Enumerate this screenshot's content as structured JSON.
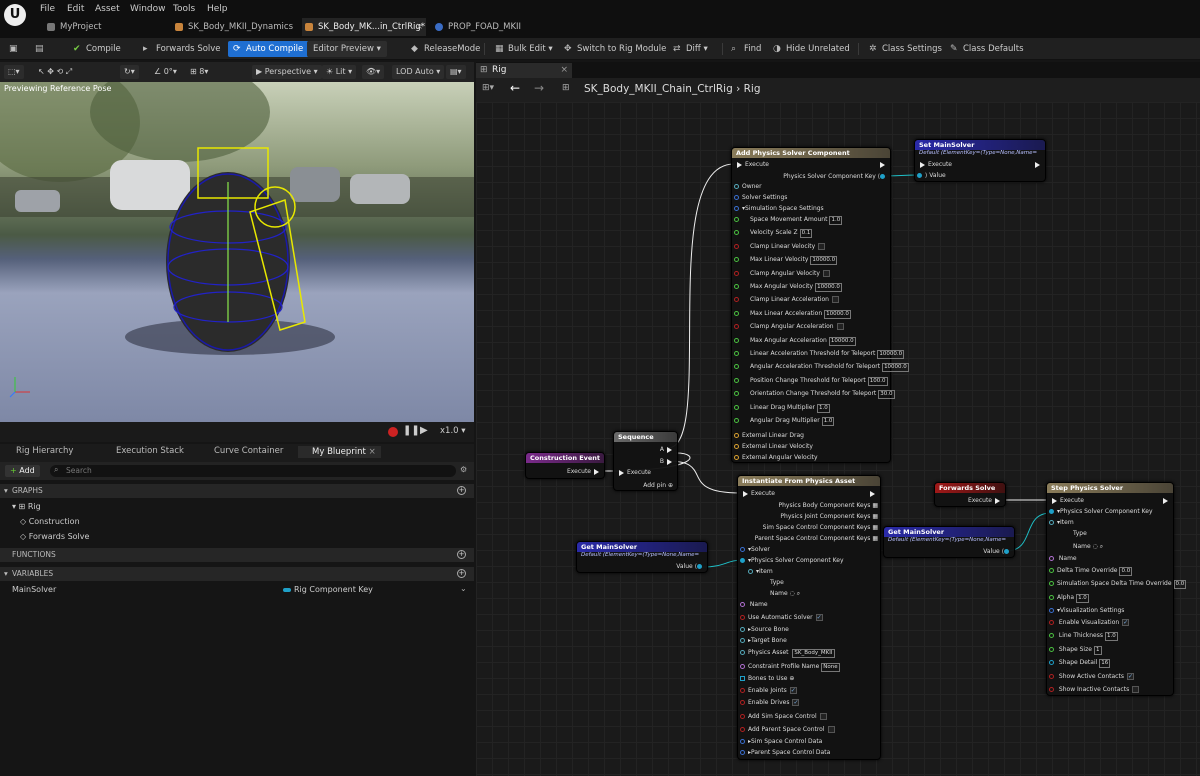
{
  "menu": [
    "File",
    "Edit",
    "Asset",
    "Window",
    "Tools",
    "Help"
  ],
  "tabs": [
    "MyProject",
    "SK_Body_MKII_Dynamics",
    "SK_Body_MK...in_CtrlRig*",
    "PROP_FOAD_MKII"
  ],
  "toolbar": {
    "compile": "Compile",
    "forwards_solve": "Forwards Solve",
    "auto_compile": "Auto Compile",
    "editor_preview": "Editor Preview",
    "release_mode": "ReleaseMode",
    "bulk_edit": "Bulk Edit",
    "switch": "Switch to Rig Module",
    "diff": "Diff",
    "find": "Find",
    "hide_unrelated": "Hide Unrelated",
    "class_settings": "Class Settings",
    "class_defaults": "Class Defaults"
  },
  "viewport": {
    "rotation": "0°",
    "snap": "8",
    "perspective": "Perspective",
    "lit": "Lit",
    "lod": "LOD Auto",
    "label": "Previewing Reference Pose",
    "speed": "x1.0"
  },
  "left_tabs": [
    "Rig Hierarchy",
    "Execution Stack",
    "Curve Container",
    "My Blueprint"
  ],
  "left": {
    "add": "Add",
    "search_placeholder": "Search",
    "graphs": "GRAPHS",
    "rig": "Rig",
    "construction": "Construction",
    "forwards": "Forwards Solve",
    "functions": "FUNCTIONS",
    "variables": "VARIABLES",
    "var_name": "MainSolver",
    "var_type": "Rig Component Key"
  },
  "graph": {
    "tab": "Rig",
    "breadcrumb1": "SK_Body_MKII_Chain_CtrlRig",
    "breadcrumb2": "Rig"
  },
  "nodes": {
    "add_physics": {
      "title": "Add Physics Solver Component",
      "exec": "Execute",
      "out": "Physics Solver Component Key",
      "owner": "Owner",
      "solver_settings": "Solver Settings",
      "sim_space": "Simulation Space Settings",
      "rows": [
        [
          "Space Movement Amount",
          "1.0"
        ],
        [
          "Velocity Scale Z",
          "0.1"
        ],
        [
          "Clamp Linear Velocity",
          ""
        ],
        [
          "Max Linear Velocity",
          "10000.0"
        ],
        [
          "Clamp Angular Velocity",
          ""
        ],
        [
          "Max Angular Velocity",
          "10000.0"
        ],
        [
          "Clamp Linear Acceleration",
          ""
        ],
        [
          "Max Linear Acceleration",
          "10000.0"
        ],
        [
          "Clamp Angular Acceleration",
          ""
        ],
        [
          "Max Angular Acceleration",
          "10000.0"
        ],
        [
          "Linear Acceleration Threshold for Teleport",
          "10000.0"
        ],
        [
          "Angular Acceleration Threshold for Teleport",
          "10000.0"
        ],
        [
          "Position Change Threshold for Teleport",
          "100.0"
        ],
        [
          "Orientation Change Threshold for Teleport",
          "30.0"
        ],
        [
          "Linear Drag Multiplier",
          "1.0"
        ],
        [
          "Angular Drag Multiplier",
          "1.0"
        ]
      ],
      "ext1": "External Linear Drag",
      "ext2": "External Linear Velocity",
      "ext3": "External Angular Velocity"
    },
    "set_main": {
      "title": "Set MainSolver",
      "sub": "Default (ElementKey=(Type=None,Name=",
      "exec": "Execute",
      "value": "Value"
    },
    "sequence": {
      "title": "Sequence",
      "a": "A",
      "b": "B",
      "exec": "Execute",
      "add": "Add pin"
    },
    "construction": {
      "title": "Construction Event",
      "exec": "Execute"
    },
    "instantiate": {
      "title": "Instantiate From Physics Asset",
      "exec": "Execute",
      "o1": "Physics Body Component Keys",
      "o2": "Physics Joint Component Keys",
      "o3": "Sim Space Control Component Keys",
      "o4": "Parent Space Control Component Keys",
      "solver": "Solver",
      "pskey": "Physics Solver Component Key",
      "item": "Item",
      "type": "Type",
      "name": "Name",
      "name2": "Name",
      "auto": "Use Automatic Solver",
      "source": "Source Bone",
      "target": "Target Bone",
      "asset": "Physics Asset",
      "asset_val": "SK_Body_MKII",
      "cpn": "Constraint Profile Name",
      "cpn_val": "None",
      "bones": "Bones to Use",
      "joints": "Enable Joints",
      "drives": "Enable Drives",
      "add_sim": "Add Sim Space Control",
      "add_parent": "Add Parent Space Control",
      "sim_data": "Sim Space Control Data",
      "parent_data": "Parent Space Control Data"
    },
    "get_main1": {
      "title": "Get MainSolver",
      "sub": "Default (ElementKey=(Type=None,Name=",
      "value": "Value"
    },
    "get_main2": {
      "title": "Get MainSolver",
      "sub": "Default (ElementKey=(Type=None,Name=",
      "value": "Value"
    },
    "forwards": {
      "title": "Forwards Solve",
      "exec": "Execute"
    },
    "step": {
      "title": "Step Physics Solver",
      "exec": "Execute",
      "pskey": "Physics Solver Component Key",
      "item": "Item",
      "type": "Type",
      "name": "Name",
      "name2": "Name",
      "delta": "Delta Time Override",
      "delta_v": "0.0",
      "simdelta": "Simulation Space Delta Time Override",
      "simdelta_v": "0.0",
      "alpha": "Alpha",
      "alpha_v": "1.0",
      "vis": "Visualization Settings",
      "enable_vis": "Enable Visualization",
      "lt": "Line Thickness",
      "lt_v": "1.0",
      "ss": "Shape Size",
      "ss_v": "1",
      "sd": "Shape Detail",
      "sd_v": "16",
      "sac": "Show Active Contacts",
      "sic": "Show Inactive Contacts"
    }
  }
}
